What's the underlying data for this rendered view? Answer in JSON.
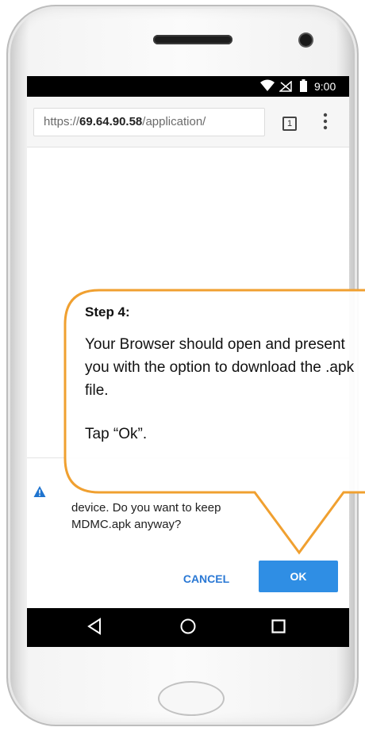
{
  "status_bar": {
    "time": "9:00"
  },
  "browser": {
    "url_scheme": "https://",
    "url_host": "69.64.90.58",
    "url_path": "/application/",
    "tab_count": "1"
  },
  "dialog": {
    "message": "device. Do you want to keep MDMC.apk anyway?",
    "cancel_label": "CANCEL",
    "ok_label": "OK"
  },
  "callout": {
    "title": "Step 4:",
    "body": "Your Browser should open and present you with the option to download the .apk file.",
    "instruction": "Tap “Ok”."
  },
  "colors": {
    "callout_border": "#f0a030",
    "primary_button": "#2f8ee4",
    "link_blue": "#2a78d4",
    "warning_blue": "#1f74cf"
  },
  "icons": {
    "wifi": "wifi-icon",
    "signal": "no-signal-icon",
    "battery": "battery-icon",
    "tabs": "tab-count-icon",
    "menu": "overflow-menu-icon",
    "warning": "warning-icon",
    "back": "back-triangle-icon",
    "home": "home-circle-icon",
    "recents": "recents-square-icon"
  }
}
